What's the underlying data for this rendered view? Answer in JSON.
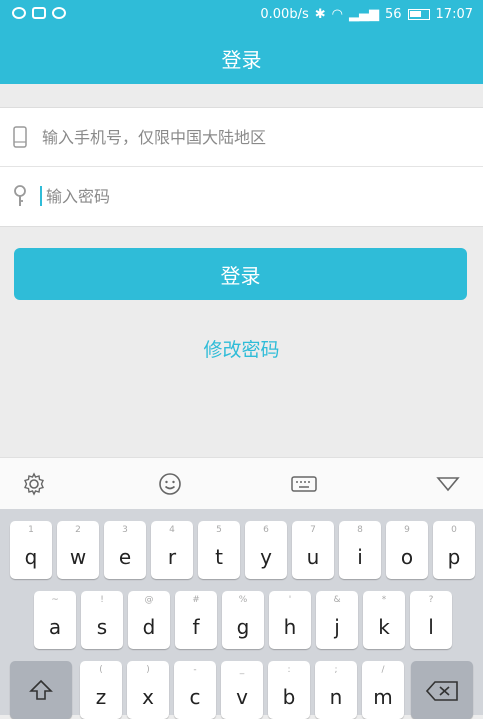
{
  "status_bar": {
    "net_speed": "0.00b/s",
    "signal": "56",
    "time": "17:07"
  },
  "app_bar": {
    "title": "登录"
  },
  "form": {
    "phone_placeholder": "输入手机号，仅限中国大陆地区",
    "password_placeholder": "输入密码"
  },
  "login_button": {
    "label": "登录"
  },
  "change_password": {
    "label": "修改密码"
  },
  "keyboard": {
    "row1": [
      {
        "k": "q",
        "h": "1"
      },
      {
        "k": "w",
        "h": "2"
      },
      {
        "k": "e",
        "h": "3"
      },
      {
        "k": "r",
        "h": "4"
      },
      {
        "k": "t",
        "h": "5"
      },
      {
        "k": "y",
        "h": "6"
      },
      {
        "k": "u",
        "h": "7"
      },
      {
        "k": "i",
        "h": "8"
      },
      {
        "k": "o",
        "h": "9"
      },
      {
        "k": "p",
        "h": "0"
      }
    ],
    "row2": [
      {
        "k": "a",
        "h": "~"
      },
      {
        "k": "s",
        "h": "!"
      },
      {
        "k": "d",
        "h": "@"
      },
      {
        "k": "f",
        "h": "#"
      },
      {
        "k": "g",
        "h": "%"
      },
      {
        "k": "h",
        "h": "'"
      },
      {
        "k": "j",
        "h": "&"
      },
      {
        "k": "k",
        "h": "*"
      },
      {
        "k": "l",
        "h": "?"
      }
    ],
    "row3": [
      {
        "k": "z",
        "h": "("
      },
      {
        "k": "x",
        "h": ")"
      },
      {
        "k": "c",
        "h": "-"
      },
      {
        "k": "v",
        "h": "_"
      },
      {
        "k": "b",
        "h": ":"
      },
      {
        "k": "n",
        "h": ";"
      },
      {
        "k": "m",
        "h": "/"
      }
    ]
  },
  "colors": {
    "accent": "#2fbcd8",
    "background": "#ececec"
  }
}
